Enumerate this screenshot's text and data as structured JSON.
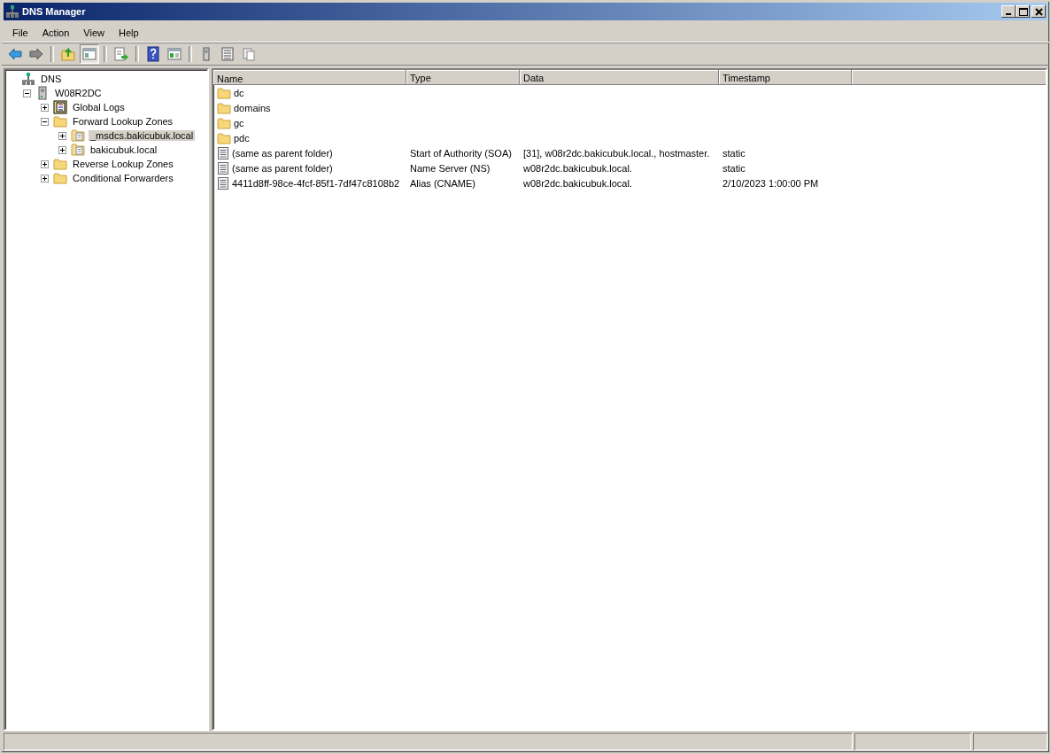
{
  "window": {
    "title": "DNS Manager"
  },
  "menu": [
    "File",
    "Action",
    "View",
    "Help"
  ],
  "toolbar": [
    {
      "kind": "back",
      "pressed": false
    },
    {
      "kind": "forward",
      "pressed": false
    },
    {
      "kind": "sep"
    },
    {
      "kind": "up",
      "pressed": false
    },
    {
      "kind": "tree",
      "pressed": true
    },
    {
      "kind": "sep"
    },
    {
      "kind": "export",
      "pressed": false
    },
    {
      "kind": "sep"
    },
    {
      "kind": "help",
      "pressed": false
    },
    {
      "kind": "pane",
      "pressed": false
    },
    {
      "kind": "sep"
    },
    {
      "kind": "server",
      "pressed": false
    },
    {
      "kind": "list",
      "pressed": false
    },
    {
      "kind": "copy",
      "pressed": false
    }
  ],
  "tree": [
    {
      "label": "DNS",
      "kind": "dns",
      "selected": false,
      "children": [
        {
          "label": "W08R2DC",
          "kind": "server",
          "expanded": true,
          "selected": false,
          "children": [
            {
              "label": "Global Logs",
              "kind": "log",
              "expanded": false,
              "selected": false
            },
            {
              "label": "Forward Lookup Zones",
              "kind": "folder",
              "expanded": true,
              "selected": false,
              "children": [
                {
                  "label": "_msdcs.bakicubuk.local",
                  "kind": "zone",
                  "expanded": false,
                  "selected": true
                },
                {
                  "label": "bakicubuk.local",
                  "kind": "zone",
                  "expanded": false,
                  "selected": false
                }
              ]
            },
            {
              "label": "Reverse Lookup Zones",
              "kind": "folder",
              "expanded": false,
              "selected": false
            },
            {
              "label": "Conditional Forwarders",
              "kind": "folder",
              "expanded": false,
              "selected": false
            }
          ]
        }
      ]
    }
  ],
  "table": {
    "columns": [
      "Name",
      "Type",
      "Data",
      "Timestamp"
    ],
    "rows": [
      {
        "kind": "folder",
        "name": "dc"
      },
      {
        "kind": "folder",
        "name": "domains"
      },
      {
        "kind": "folder",
        "name": "gc"
      },
      {
        "kind": "folder",
        "name": "pdc"
      },
      {
        "kind": "record",
        "name": "(same as parent folder)",
        "type": "Start of Authority (SOA)",
        "data": "[31], w08r2dc.bakicubuk.local., hostmaster.",
        "timestamp": "static"
      },
      {
        "kind": "record",
        "name": "(same as parent folder)",
        "type": "Name Server (NS)",
        "data": "w08r2dc.bakicubuk.local.",
        "timestamp": "static"
      },
      {
        "kind": "record",
        "name": "4411d8ff-98ce-4fcf-85f1-7df47c8108b2",
        "type": "Alias (CNAME)",
        "data": "w08r2dc.bakicubuk.local.",
        "timestamp": "2/10/2023 1:00:00 PM"
      }
    ]
  }
}
